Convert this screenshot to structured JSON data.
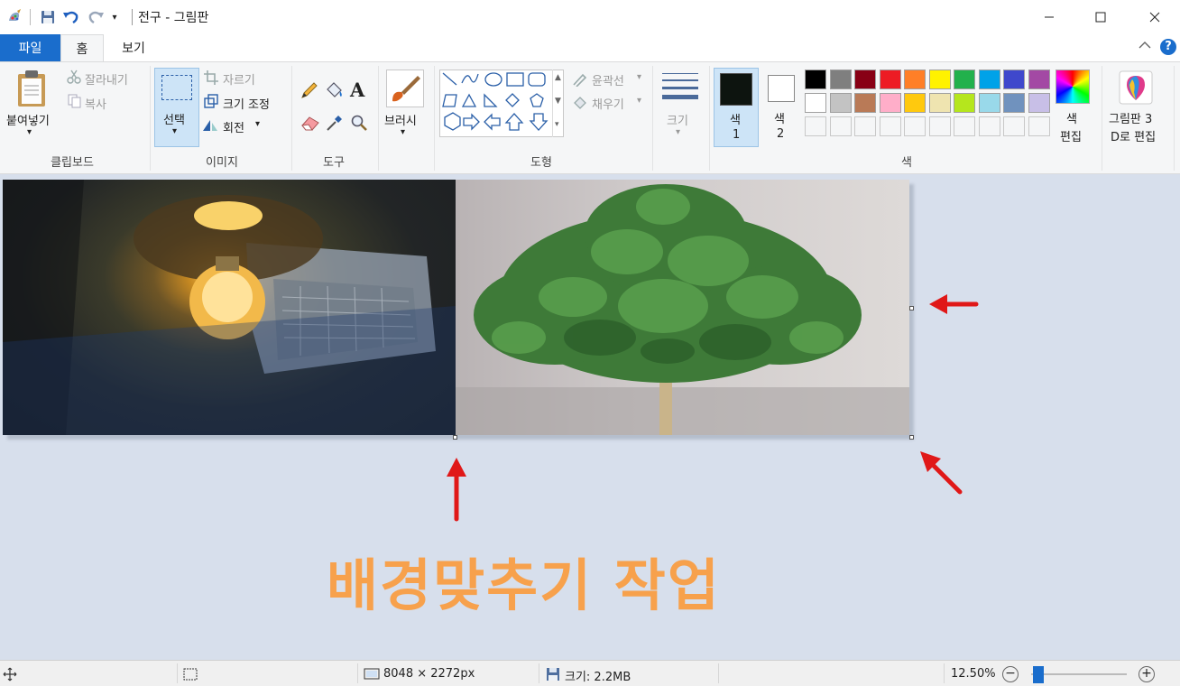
{
  "window": {
    "title": "전구 - 그림판"
  },
  "tabs": {
    "file": "파일",
    "home": "홈",
    "view": "보기"
  },
  "clipboard": {
    "paste": "붙여넣기",
    "cut": "잘라내기",
    "copy": "복사",
    "group": "클립보드"
  },
  "image": {
    "select": "선택",
    "crop": "자르기",
    "resize": "크기 조정",
    "rotate": "회전",
    "group": "이미지"
  },
  "tools": {
    "group": "도구"
  },
  "brushes": {
    "label": "브러시"
  },
  "shapes": {
    "outline": "윤곽선",
    "fill": "채우기",
    "group": "도형"
  },
  "size": {
    "label": "크기"
  },
  "colors": {
    "color1_line1": "색",
    "color1_line2": "1",
    "color2_line1": "색",
    "color2_line2": "2",
    "edit_line1": "색",
    "edit_line2": "편집",
    "group": "색",
    "color1": "#0d140f",
    "color2": "#ffffff",
    "palette_row1": [
      "#000000",
      "#7f7f7f",
      "#880015",
      "#ed1c24",
      "#ff7f27",
      "#fff200",
      "#22b14c",
      "#00a2e8",
      "#3f48cc",
      "#a349a4"
    ],
    "palette_row2": [
      "#ffffff",
      "#c3c3c3",
      "#b97a57",
      "#ffaec9",
      "#ffc90e",
      "#efe4b0",
      "#b5e61d",
      "#99d9ea",
      "#7092be",
      "#c8bfe7"
    ]
  },
  "paint3d": {
    "line1": "그림판 3",
    "line2": "D로 편집"
  },
  "status": {
    "dimensions": "8048 × 2272px",
    "size": "크기: 2.2MB",
    "zoom": "12.50%",
    "zoom_level_fraction": 0.02
  },
  "overlay": {
    "caption": "배경맞추기 작업"
  },
  "accent": "#1a6dcc",
  "arrow_color": "#e01818"
}
